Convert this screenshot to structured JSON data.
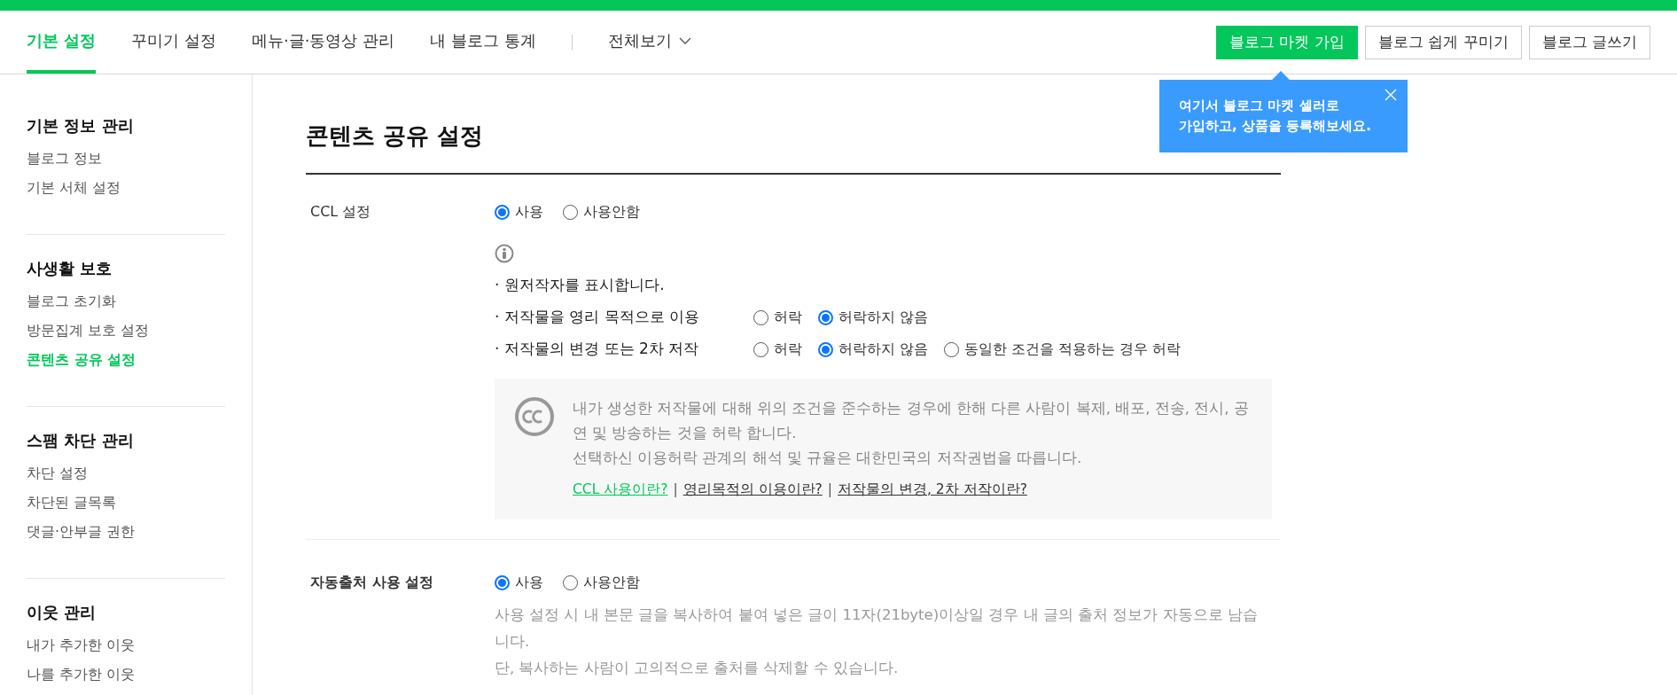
{
  "top_nav": {
    "tabs": [
      {
        "label": "기본 설정",
        "selected": true
      },
      {
        "label": "꾸미기 설정",
        "selected": false
      },
      {
        "label": "메뉴·글·동영상 관리",
        "selected": false
      },
      {
        "label": "내 블로그 통계",
        "selected": false
      }
    ],
    "all_view": "전체보기",
    "buttons": [
      {
        "label": "블로그 마켓 가입",
        "kind": "primary"
      },
      {
        "label": "블로그 쉽게 꾸미기",
        "kind": "outline"
      },
      {
        "label": "블로그 글쓰기",
        "kind": "outline"
      }
    ]
  },
  "tooltip": {
    "lines": [
      "여기서 블로그 마켓 셀러로",
      "가입하고, 상품을 등록해보세요."
    ]
  },
  "sidebar": {
    "sections": [
      {
        "title": "기본 정보 관리",
        "items": [
          {
            "label": "블로그 정보",
            "selected": false
          },
          {
            "label": "기본 서체 설정",
            "selected": false
          }
        ]
      },
      {
        "title": "사생활 보호",
        "items": [
          {
            "label": "블로그 초기화",
            "selected": false
          },
          {
            "label": "방문집계 보호 설정",
            "selected": false
          },
          {
            "label": "콘텐츠 공유 설정",
            "selected": true
          }
        ]
      },
      {
        "title": "스팸 차단 관리",
        "items": [
          {
            "label": "차단 설정",
            "selected": false
          },
          {
            "label": "차단된 글목록",
            "selected": false
          },
          {
            "label": "댓글·안부글 권한",
            "selected": false
          }
        ]
      },
      {
        "title": "이웃 관리",
        "items": [
          {
            "label": "내가 추가한 이웃",
            "selected": false
          },
          {
            "label": "나를 추가한 이웃",
            "selected": false
          }
        ]
      }
    ]
  },
  "page_title": "콘텐츠 공유 설정",
  "ccl": {
    "label": "CCL 설정",
    "options": [
      {
        "label": "사용",
        "selected": true
      },
      {
        "label": "사용안함",
        "selected": false
      }
    ],
    "conditions": [
      {
        "text": "· 원저작자를 표시합니다."
      },
      {
        "text": "· 저작물을 영리 목적으로 이용",
        "options": [
          {
            "label": "허락",
            "selected": false
          },
          {
            "label": "허락하지 않음",
            "selected": true
          }
        ]
      },
      {
        "text": "· 저작물의 변경 또는 2차 저작",
        "options": [
          {
            "label": "허락",
            "selected": false
          },
          {
            "label": "허락하지 않음",
            "selected": true
          },
          {
            "label": "동일한 조건을 적용하는 경우 허락",
            "selected": false
          }
        ]
      }
    ],
    "info": {
      "lines": [
        "내가 생성한 저작물에 대해 위의 조건을 준수하는 경우에 한해 다른 사람이 복제, 배포, 전송, 전시, 공연 및 방송하는 것을 허락 합니다.",
        "선택하신 이용허락 관계의 해석 및 규율은 대한민국의 저작권법을 따릅니다."
      ],
      "links": [
        {
          "label": "CCL 사용이란?",
          "color": "#03c75a"
        },
        {
          "label": "영리목적의 이용이란?",
          "color": "#333333"
        },
        {
          "label": "저작물의 변경, 2차 저작이란?",
          "color": "#333333"
        }
      ],
      "separator": "|"
    }
  },
  "auto_source": {
    "label": "자동출처 사용 설정",
    "options": [
      {
        "label": "사용",
        "selected": true
      },
      {
        "label": "사용안함",
        "selected": false
      }
    ],
    "help": [
      "사용 설정 시 내 본문 글을 복사하여 붙여 넣은 글이 11자(21byte)이상일 경우 내 글의 출처 정보가 자동으로 남습니다.",
      "단, 복사하는 사람이 고의적으로 출처를 삭제할 수 있습니다."
    ]
  }
}
